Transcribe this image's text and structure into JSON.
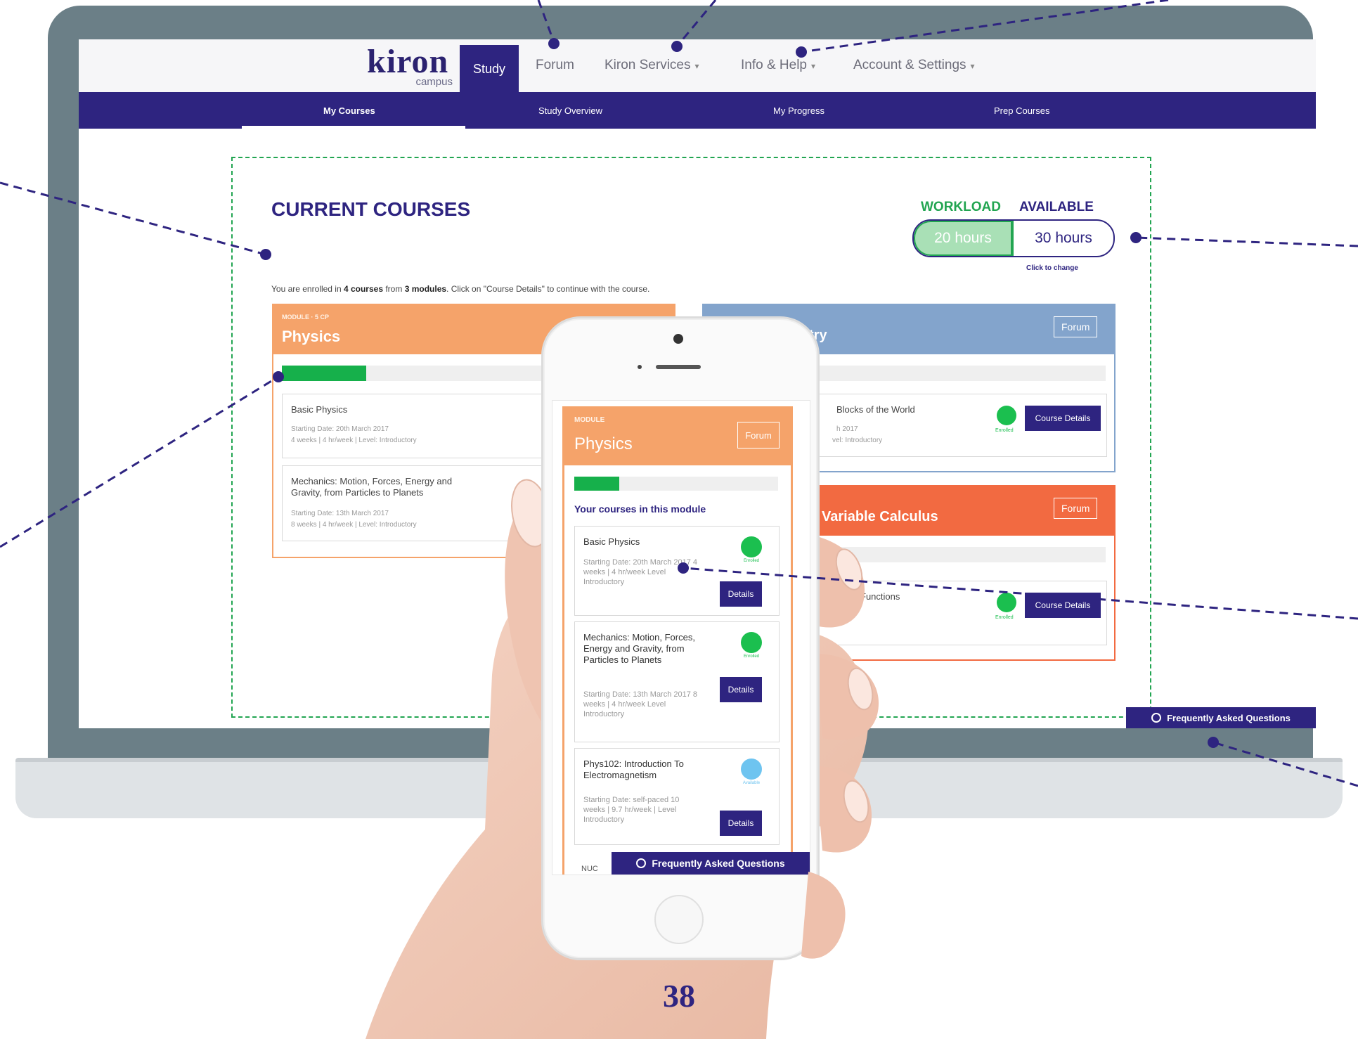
{
  "brand": {
    "logo": "kiron",
    "logo_sub": "campus"
  },
  "topnav": {
    "active_tab": "Study",
    "items": [
      {
        "label": "Forum",
        "dropdown": false
      },
      {
        "label": "Kiron Services",
        "dropdown": true
      },
      {
        "label": "Info & Help",
        "dropdown": true
      },
      {
        "label": "Account & Settings",
        "dropdown": true
      }
    ],
    "caret": "▾"
  },
  "subnav": {
    "items": [
      "My Courses",
      "Study Overview",
      "My Progress",
      "Prep Courses"
    ],
    "active": "My Courses"
  },
  "main": {
    "title": "CURRENT COURSES",
    "enrolled": {
      "pre": "You are enrolled in ",
      "courses": "4 courses",
      "mid": " from ",
      "modules": "3 modules",
      "post": ". Click on \"Course Details\" to continue with the course."
    },
    "workload": {
      "workload_label": "WORKLOAD",
      "available_label": "AVAILABLE",
      "workload_value": "20 hours",
      "available_value": "30 hours",
      "click_to_change": "Click to change"
    }
  },
  "cards": {
    "physics": {
      "tag": "MODULE · 5 CP",
      "title": "Physics",
      "progress": 0.22,
      "courses": [
        {
          "title": "Basic Physics",
          "meta1": "Starting Date: 20th March 2017",
          "meta2": "4 weeks | 4 hr/week | Level: Introductory"
        },
        {
          "title": "Mechanics: Motion, Forces, Energy and Gravity, from Particles to Planets",
          "meta1": "Starting Date: 13th March 2017",
          "meta2": "8 weeks | 4 hr/week | Level: Introductory"
        }
      ]
    },
    "geometry": {
      "title_fragment": "try",
      "forum": "Forum",
      "course_fragment": "Blocks of the World",
      "meta1_fragment": "h 2017",
      "meta2_fragment": "vel: Introductory",
      "status": "Enrolled",
      "details": "Course Details"
    },
    "calculus": {
      "title_fragment": "Variable Calculus",
      "forum": "Forum",
      "course_fragment": "Functions",
      "status": "Enrolled",
      "details": "Course Details"
    }
  },
  "faq": {
    "label": "Frequently Asked Questions"
  },
  "mobile": {
    "tag": "MODULE",
    "title": "Physics",
    "forum": "Forum",
    "progress": 0.22,
    "section": "Your courses in this module",
    "courses": [
      {
        "title": "Basic Physics",
        "meta": "Starting Date: 20th March 2017 4 weeks | 4 hr/week Level Introductory",
        "status": "Enrolled",
        "details": "Details"
      },
      {
        "title": "Mechanics: Motion, Forces, Energy and Gravity, from Particles to Planets",
        "meta": "Starting Date: 13th March 2017 8 weeks | 4 hr/week Level Introductory",
        "status": "Enrolled",
        "details": "Details"
      },
      {
        "title": "Phys102: Introduction To Electromagnetism",
        "meta": "Starting Date: self-paced 10 weeks | 9.7 hr/week | Level Introductory",
        "status": "Available",
        "details": "Details"
      }
    ],
    "next_course_fragment": "NUC",
    "faq": "Frequently Asked Questions"
  },
  "page_number": "38",
  "colors": {
    "navy": "#2e2480",
    "green": "#16b04b",
    "orange": "#f5a36a",
    "blue": "#83a4cc",
    "red_orange": "#f26a41",
    "bezel": "#6b7f87"
  }
}
